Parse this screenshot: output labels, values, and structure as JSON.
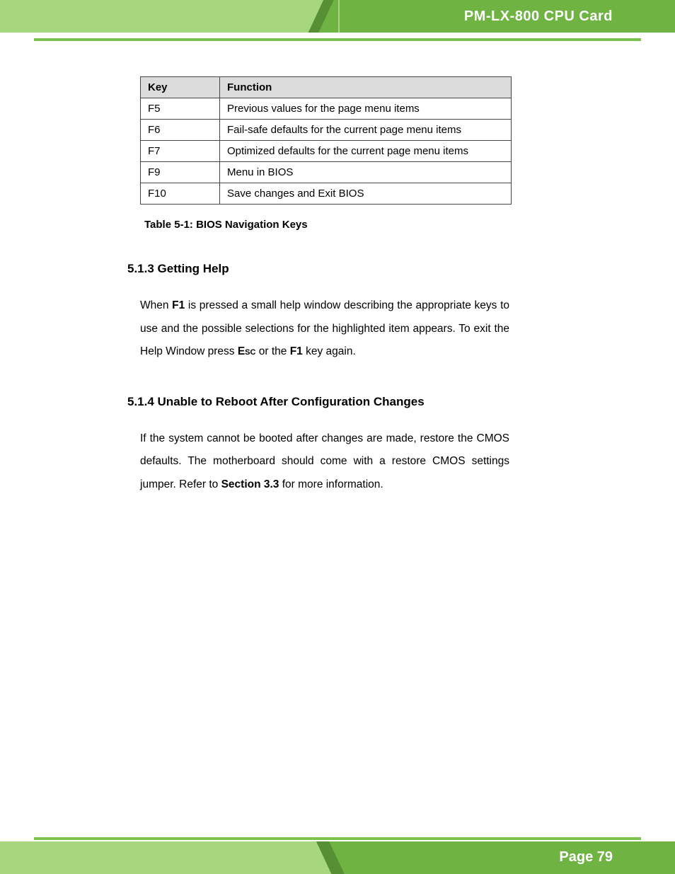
{
  "header": {
    "title": "PM-LX-800 CPU Card"
  },
  "table": {
    "headers": {
      "key": "Key",
      "function": "Function"
    },
    "rows": [
      {
        "key": "F5",
        "function": "Previous values for the page menu items"
      },
      {
        "key": "F6",
        "function": "Fail-safe defaults for the current page menu items"
      },
      {
        "key": "F7",
        "function": "Optimized defaults for the current page menu items"
      },
      {
        "key": "F9",
        "function": "Menu in BIOS"
      },
      {
        "key": "F10",
        "function": "Save changes and Exit BIOS"
      }
    ],
    "caption": "Table 5-1: BIOS Navigation Keys"
  },
  "sections": {
    "help": {
      "heading": "5.1.3 Getting Help",
      "p": {
        "a": "When ",
        "b": "F1",
        "c": " is pressed a small help window describing the appropriate keys to use and the possible selections for the highlighted item appears. To exit the Help Window press ",
        "d": "Esc",
        "e": " or the ",
        "f": "F1",
        "g": " key again."
      }
    },
    "reboot": {
      "heading": "5.1.4 Unable to Reboot After Configuration Changes",
      "p": {
        "a": "If the system cannot be booted after changes are made, restore the CMOS defaults. The motherboard should come with a restore CMOS settings jumper. Refer to ",
        "b": "Section 3.3",
        "c": " for more information."
      }
    }
  },
  "footer": {
    "page": "Page 79"
  }
}
